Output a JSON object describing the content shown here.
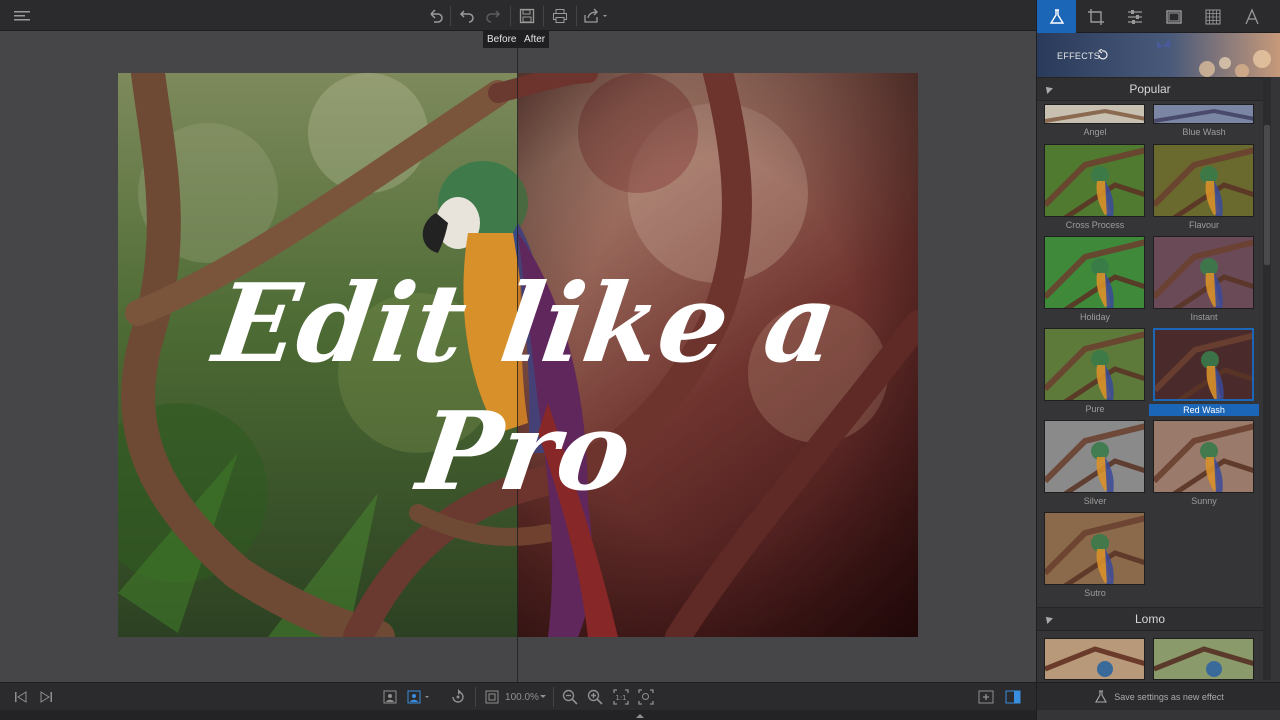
{
  "toolbar": {
    "menu_icon": "hamburger-icon",
    "undo_icon": "undo-icon",
    "redo_icon": "redo-icon",
    "save_icon": "save-icon",
    "print_icon": "print-icon",
    "share_icon": "share-icon"
  },
  "compare": {
    "before_label": "Before",
    "after_label": "After"
  },
  "overlay": {
    "line1": "Edit like a",
    "line2": "Pro"
  },
  "bottombar": {
    "zoom": "100.0%"
  },
  "panel": {
    "tabs": [
      {
        "name": "effects-tab",
        "icon": "flask-icon",
        "active": true
      },
      {
        "name": "crop-tab",
        "icon": "crop-icon",
        "active": false
      },
      {
        "name": "adjust-tab",
        "icon": "sliders-icon",
        "active": false
      },
      {
        "name": "frames-tab",
        "icon": "frame-icon",
        "active": false
      },
      {
        "name": "textures-tab",
        "icon": "grid-icon",
        "active": false
      },
      {
        "name": "text-tab",
        "icon": "text-icon",
        "active": false
      }
    ],
    "header_label": "EFFECTS",
    "section_popular": "Popular",
    "section_lomo": "Lomo",
    "effects": [
      {
        "label": "Angel",
        "tint": "#c8c0b0"
      },
      {
        "label": "Blue Wash",
        "tint": "#7a86a4"
      },
      {
        "label": "Cross Process",
        "tint": "#4f7a2f"
      },
      {
        "label": "Flavour",
        "tint": "#6a6a2e"
      },
      {
        "label": "Holiday",
        "tint": "#3f8a3a"
      },
      {
        "label": "Instant",
        "tint": "#6a4a56"
      },
      {
        "label": "Pure",
        "tint": "#5e7a3a"
      },
      {
        "label": "Red Wash",
        "tint": "#4a2a2a"
      },
      {
        "label": "Silver",
        "tint": "#8a8a8a"
      },
      {
        "label": "Sunny",
        "tint": "#9a7a6a"
      },
      {
        "label": "Sutro",
        "tint": "#8a6a4a"
      }
    ],
    "selected_effect": "Red Wash",
    "save_label": "Save settings as new effect"
  }
}
